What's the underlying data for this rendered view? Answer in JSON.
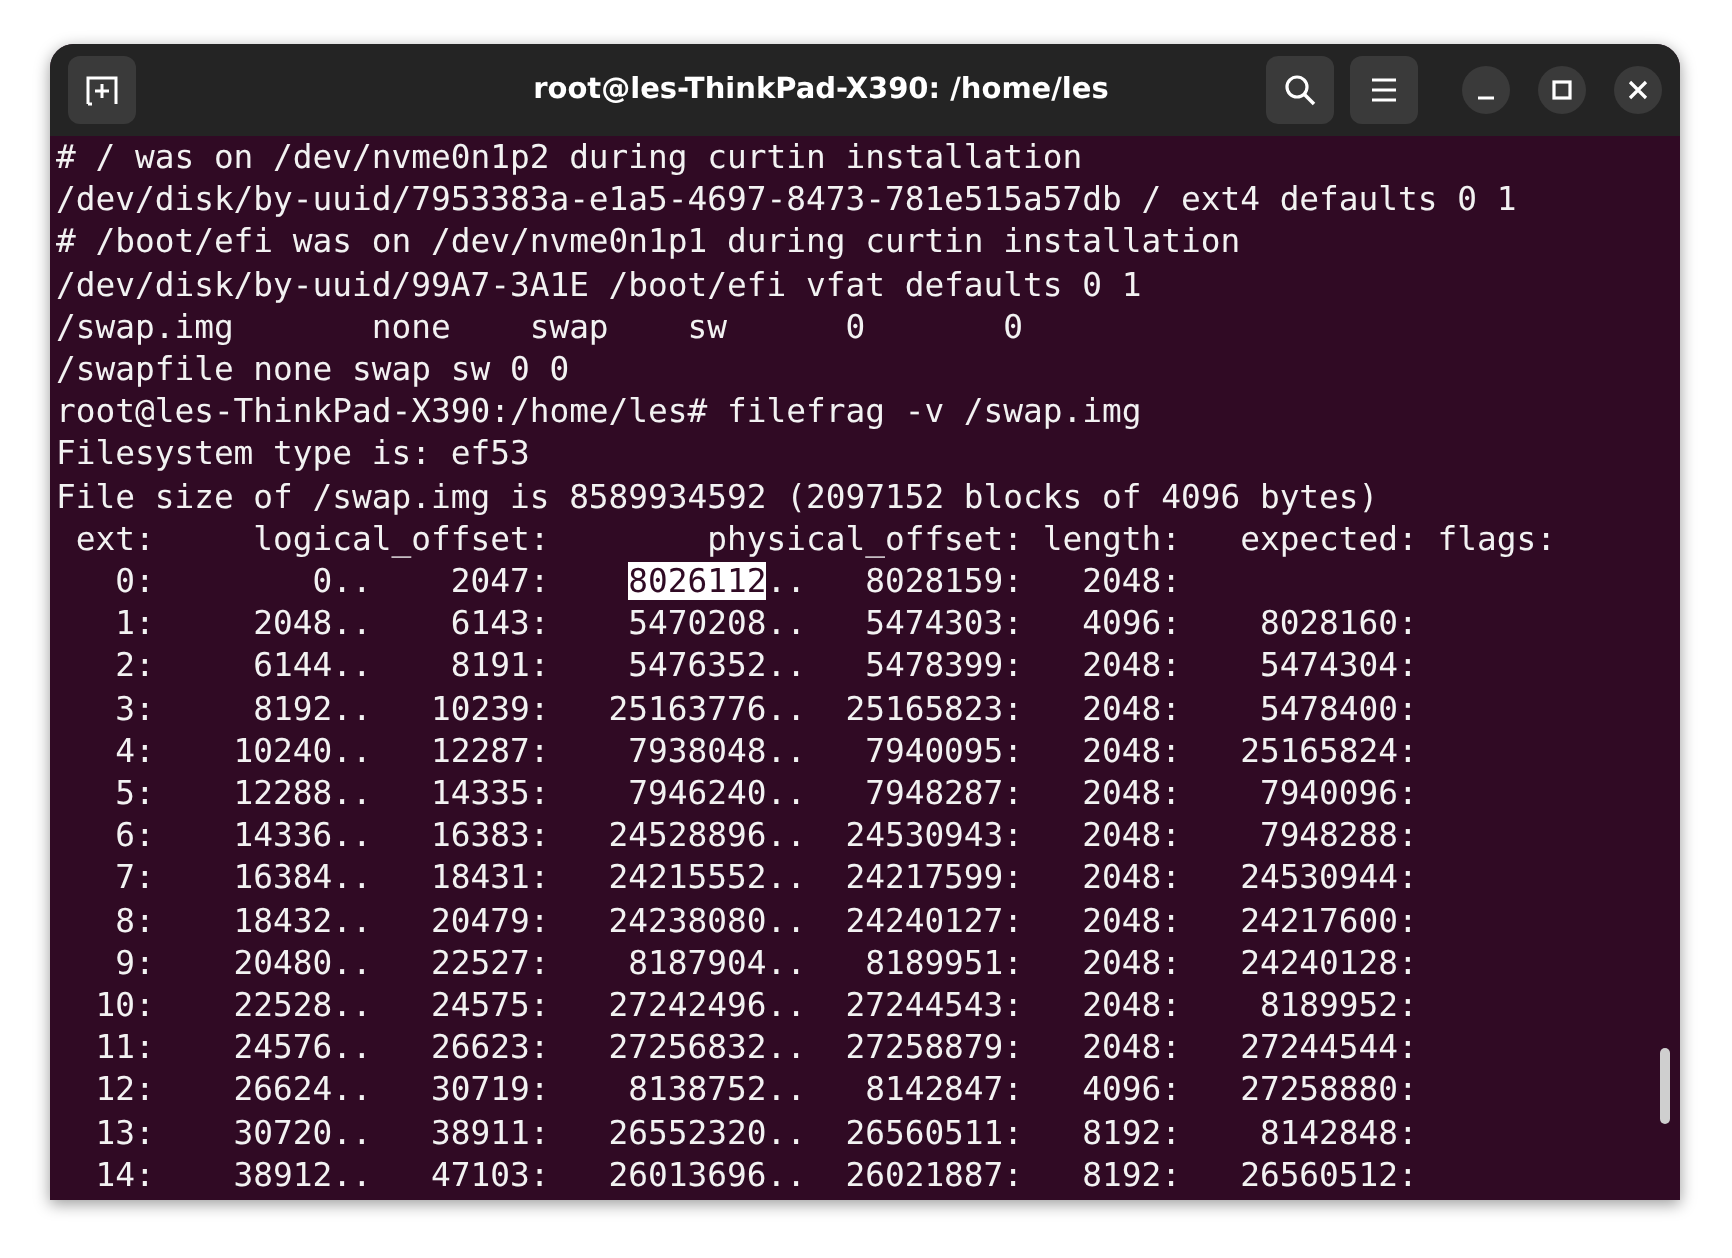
{
  "window": {
    "title": "root@les-ThinkPad-X390: /home/les"
  },
  "terminal": {
    "lines": [
      {
        "text": "# / was on /dev/nvme0n1p2 during curtin installation"
      },
      {
        "text": "/dev/disk/by-uuid/7953383a-e1a5-4697-8473-781e515a57db / ext4 defaults 0 1"
      },
      {
        "text": "# /boot/efi was on /dev/nvme0n1p1 during curtin installation"
      },
      {
        "text": "/dev/disk/by-uuid/99A7-3A1E /boot/efi vfat defaults 0 1"
      },
      {
        "text": "/swap.img       none    swap    sw      0       0"
      },
      {
        "text": "/swapfile none swap sw 0 0"
      },
      {
        "text": "root@les-ThinkPad-X390:/home/les# filefrag -v /swap.img"
      },
      {
        "text": "Filesystem type is: ef53"
      },
      {
        "text": "File size of /swap.img is 8589934592 (2097152 blocks of 4096 bytes)"
      },
      {
        "text": " ext:     logical_offset:        physical_offset: length:   expected: flags:"
      },
      {
        "segments": [
          {
            "text": "   0:        0..    2047:    ",
            "selected": false
          },
          {
            "text": "8026112",
            "selected": true
          },
          {
            "text": "..   8028159:   2048:",
            "selected": false
          }
        ]
      },
      {
        "text": "   1:     2048..    6143:    5470208..   5474303:   4096:    8028160:"
      },
      {
        "text": "   2:     6144..    8191:    5476352..   5478399:   2048:    5474304:"
      },
      {
        "text": "   3:     8192..   10239:   25163776..  25165823:   2048:    5478400:"
      },
      {
        "text": "   4:    10240..   12287:    7938048..   7940095:   2048:   25165824:"
      },
      {
        "text": "   5:    12288..   14335:    7946240..   7948287:   2048:    7940096:"
      },
      {
        "text": "   6:    14336..   16383:   24528896..  24530943:   2048:    7948288:"
      },
      {
        "text": "   7:    16384..   18431:   24215552..  24217599:   2048:   24530944:"
      },
      {
        "text": "   8:    18432..   20479:   24238080..  24240127:   2048:   24217600:"
      },
      {
        "text": "   9:    20480..   22527:    8187904..   8189951:   2048:   24240128:"
      },
      {
        "text": "  10:    22528..   24575:   27242496..  27244543:   2048:    8189952:"
      },
      {
        "text": "  11:    24576..   26623:   27256832..  27258879:   2048:   27244544:"
      },
      {
        "text": "  12:    26624..   30719:    8138752..   8142847:   4096:   27258880:"
      },
      {
        "text": "  13:    30720..   38911:   26552320..  26560511:   8192:    8142848:"
      },
      {
        "text": "  14:    38912..   47103:   26013696..  26021887:   8192:   26560512:"
      }
    ]
  }
}
